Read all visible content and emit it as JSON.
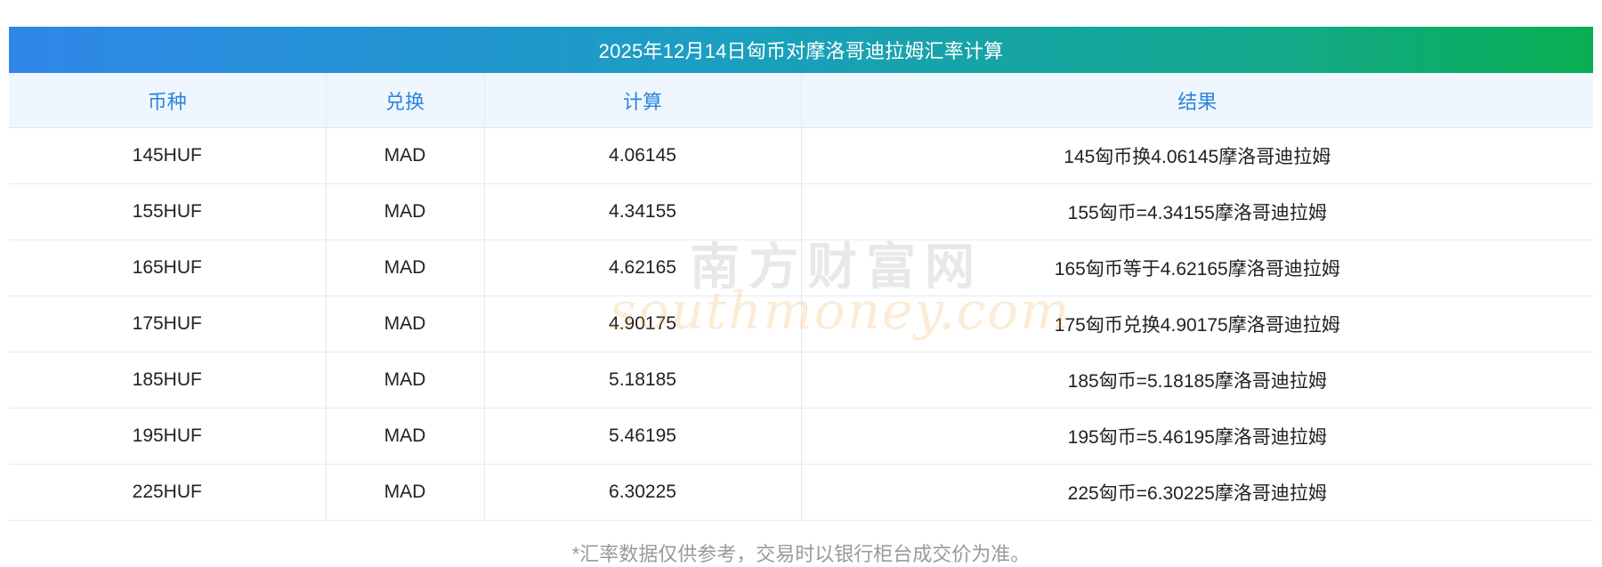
{
  "title": "2025年12月14日匈币对摩洛哥迪拉姆汇率计算",
  "columns": [
    "币种",
    "兑换",
    "计算",
    "结果"
  ],
  "rows": [
    {
      "currency": "145HUF",
      "target": "MAD",
      "value": "4.06145",
      "result": "145匈币换4.06145摩洛哥迪拉姆"
    },
    {
      "currency": "155HUF",
      "target": "MAD",
      "value": "4.34155",
      "result": "155匈币=4.34155摩洛哥迪拉姆"
    },
    {
      "currency": "165HUF",
      "target": "MAD",
      "value": "4.62165",
      "result": "165匈币等于4.62165摩洛哥迪拉姆"
    },
    {
      "currency": "175HUF",
      "target": "MAD",
      "value": "4.90175",
      "result": "175匈币兑换4.90175摩洛哥迪拉姆"
    },
    {
      "currency": "185HUF",
      "target": "MAD",
      "value": "5.18185",
      "result": "185匈币=5.18185摩洛哥迪拉姆"
    },
    {
      "currency": "195HUF",
      "target": "MAD",
      "value": "5.46195",
      "result": "195匈币=5.46195摩洛哥迪拉姆"
    },
    {
      "currency": "225HUF",
      "target": "MAD",
      "value": "6.30225",
      "result": "225匈币=6.30225摩洛哥迪拉姆"
    }
  ],
  "footnote": "*汇率数据仅供参考，交易时以银行柜台成交价为准。",
  "watermark": {
    "cn": "南方财富网",
    "en": "southmoney.com"
  },
  "colors": {
    "title_start": "#2f86e8",
    "title_end": "#0aae52",
    "header_text": "#2a86db",
    "header_bg": "#f0f6fe"
  }
}
